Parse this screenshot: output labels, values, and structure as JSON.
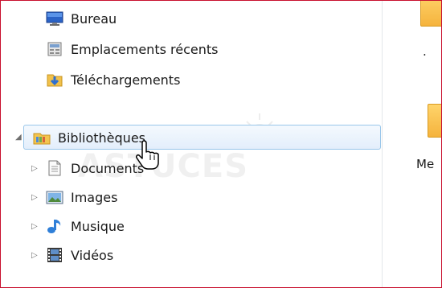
{
  "nav": {
    "favorites": [
      {
        "label": "Bureau",
        "icon": "desktop-icon"
      },
      {
        "label": "Emplacements récents",
        "icon": "recent-places-icon"
      },
      {
        "label": "Téléchargements",
        "icon": "downloads-icon"
      }
    ],
    "libraries": {
      "label": "Bibliothèques",
      "icon": "libraries-icon",
      "expanded": true,
      "children": [
        {
          "label": "Documents",
          "icon": "documents-icon"
        },
        {
          "label": "Images",
          "icon": "images-icon"
        },
        {
          "label": "Musique",
          "icon": "music-icon"
        },
        {
          "label": "Vidéos",
          "icon": "videos-icon"
        }
      ]
    }
  },
  "watermark": {
    "text": "ASTUCES"
  },
  "right_pane": {
    "partial_label_1": ".",
    "partial_label_2": "Me"
  },
  "colors": {
    "selection_border": "#99c6ea",
    "selection_fill": "#e8f1fb",
    "frame_border": "#c8102e",
    "folder": "#f5c04a"
  }
}
